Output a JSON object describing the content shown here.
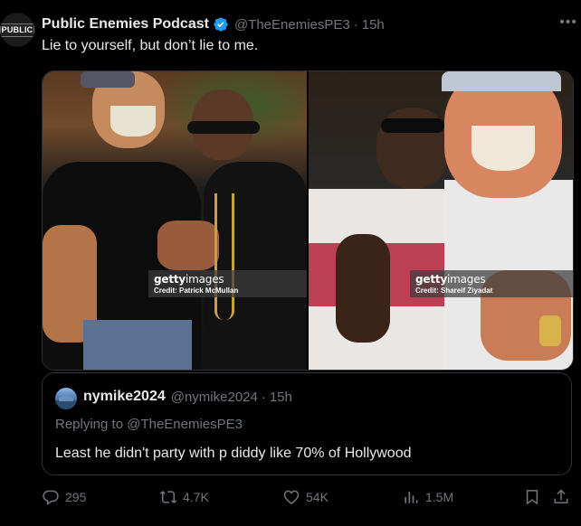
{
  "author": {
    "avatar_text": "PUBLIC",
    "name": "Public Enemies Podcast",
    "handle": "@TheEnemiesPE3",
    "separator": "·",
    "time": "15h",
    "verified": true
  },
  "tweet_text": "Lie to yourself, but don’t lie to me.",
  "media": {
    "photo1": {
      "logo_bold": "getty",
      "logo_light": "images",
      "credit": "Credit: Patrick McMullan"
    },
    "photo2": {
      "logo_bold": "getty",
      "logo_light": "images",
      "credit": "Credit: Shareif Ziyadat"
    }
  },
  "quote": {
    "name": "nymike2024",
    "handle": "@nymike2024",
    "separator": "·",
    "time": "15h",
    "replying_prefix": "Replying to",
    "replying_to": "@TheEnemiesPE3",
    "text": "Least he didn't party with p diddy like 70% of Hollywood"
  },
  "actions": {
    "replies": "295",
    "reposts": "4.7K",
    "likes": "54K",
    "views": "1.5M"
  },
  "colors": {
    "background": "#000000",
    "text": "#e7e9ea",
    "secondary": "#71767b",
    "border": "#2f3336",
    "verified": "#1d9bf0"
  },
  "icons": [
    "more-icon",
    "verified-icon",
    "reply-icon",
    "repost-icon",
    "like-icon",
    "views-icon",
    "bookmark-icon",
    "share-icon"
  ]
}
